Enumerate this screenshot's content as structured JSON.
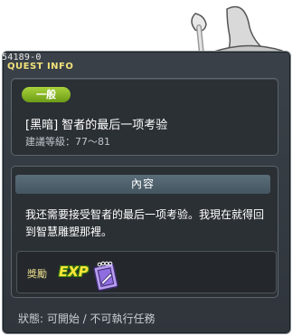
{
  "quest": {
    "id": "54189-0",
    "header_title": "QUEST INFO",
    "category_badge": "一般",
    "name": "[黑暗] 智者的最后一项考验",
    "level_requirement": "建議等級：77〜81",
    "content_header": "內容",
    "description": "我还需要接受智者的最后一项考验。我現在就得回到智慧雕塑那裡。",
    "reward_label": "獎勵",
    "reward_exp_label": "EXP",
    "reward_item_icon": "spellbook-icon",
    "status_text": "狀態: 可開始 / 不可執行任務"
  },
  "colors": {
    "window_bg": "#2f353b",
    "title_yellow": "#f1e27a",
    "badge_green": "#8cbc28",
    "content_header_bg": "#4e626e"
  }
}
